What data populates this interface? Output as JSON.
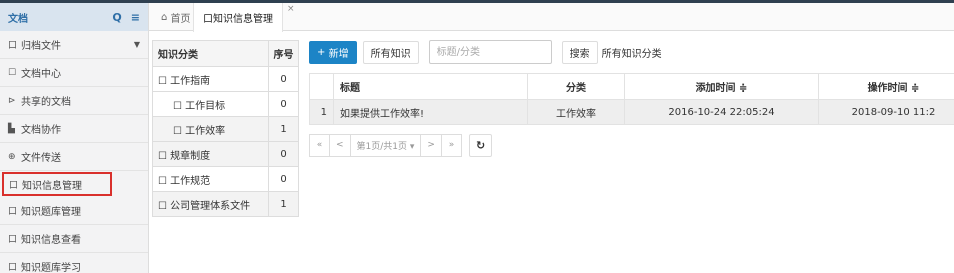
{
  "sidebar": {
    "title": "文档",
    "search_icon": "Q",
    "menu_icon": "≡",
    "items": [
      {
        "icon": "口",
        "label": "归档文件",
        "caret": "▼"
      },
      {
        "icon": "☐",
        "label": "文档中心"
      },
      {
        "icon": "⊳",
        "label": "共享的文档"
      },
      {
        "icon": "▙",
        "label": "文档协作"
      },
      {
        "icon": "⊕",
        "label": "文件传送"
      },
      {
        "icon": "口",
        "label": "知识信息管理"
      },
      {
        "icon": "口",
        "label": "知识题库管理"
      },
      {
        "icon": "口",
        "label": "知识信息查看"
      },
      {
        "icon": "口",
        "label": "知识题库学习"
      }
    ]
  },
  "tabs": {
    "home_icon": "⌂",
    "home": "首页",
    "active_icon": "口",
    "active": "知识信息管理",
    "close": "×"
  },
  "categories": {
    "header_name": "知识分类",
    "header_order": "序号",
    "rows": [
      {
        "icon": "☐",
        "name": "工作指南",
        "order": "0"
      },
      {
        "icon": "☐",
        "name": "工作目标",
        "order": "0"
      },
      {
        "icon": "☐",
        "name": "工作效率",
        "order": "1"
      },
      {
        "icon": "☐",
        "name": "规章制度",
        "order": "0"
      },
      {
        "icon": "☐",
        "name": "工作规范",
        "order": "0"
      },
      {
        "icon": "☐",
        "name": "公司管理体系文件",
        "order": "1"
      }
    ]
  },
  "toolbar": {
    "new_icon": "+",
    "new_label": "新增",
    "all_label": "所有知识",
    "search_placeholder": "标题/分类",
    "search_label": "搜索",
    "filter_label": "所有知识分类"
  },
  "table": {
    "columns": [
      "",
      "标题",
      "分类",
      "添加时间 ≑",
      "操作时间 ≑"
    ],
    "rows": [
      [
        "1",
        "如果提供工作效率!",
        "工作效率",
        "2016-10-24 22:05:24",
        "2018-09-10 11:2"
      ]
    ]
  },
  "pager": {
    "first": "«",
    "prev": "<",
    "page_label": "第1页/共1页 ▾",
    "next": ">",
    "last": "»",
    "refresh": "↻"
  }
}
